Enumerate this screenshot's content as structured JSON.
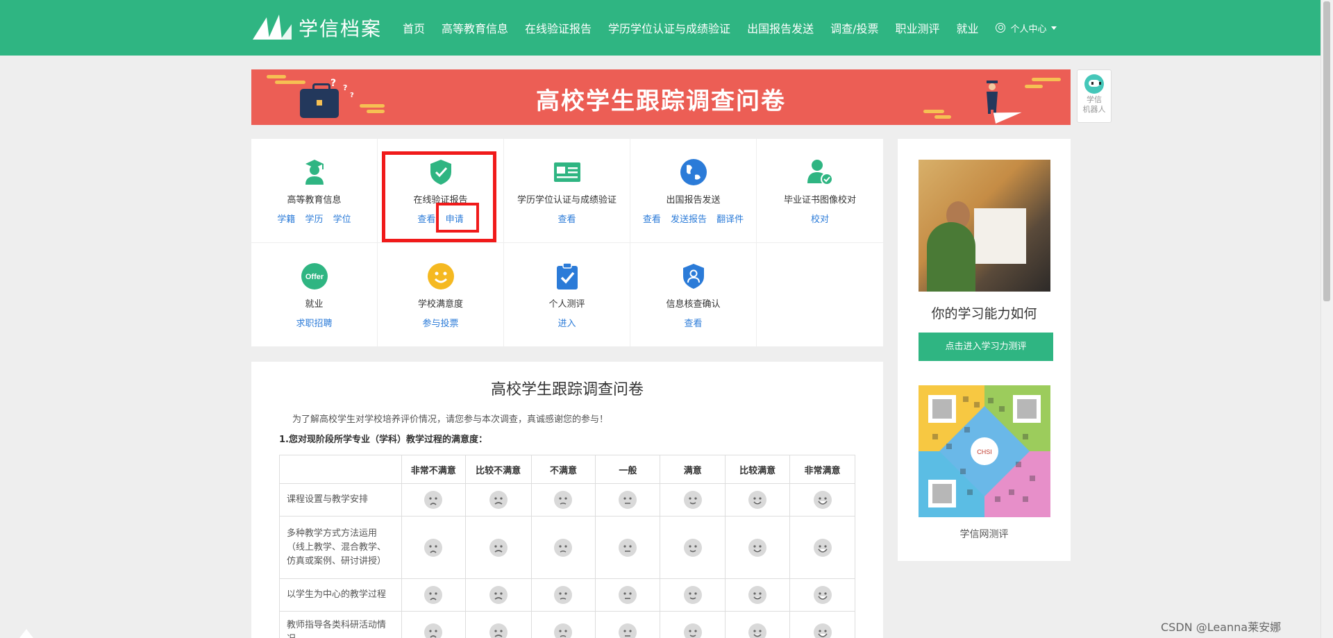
{
  "header": {
    "logo_text": "学信档案",
    "nav": [
      "首页",
      "高等教育信息",
      "在线验证报告",
      "学历学位认证与成绩验证",
      "出国报告发送",
      "调查/投票",
      "职业测评",
      "就业"
    ],
    "user_menu": "个人中心"
  },
  "banner": {
    "title": "高校学生跟踪调查问卷"
  },
  "robot": {
    "line1": "学信",
    "line2": "机器人"
  },
  "services": [
    {
      "title": "高等教育信息",
      "links": [
        "学籍",
        "学历",
        "学位"
      ],
      "icon": "graduate-icon",
      "color": "#2fb582"
    },
    {
      "title": "在线验证报告",
      "links": [
        "查看",
        "申请"
      ],
      "icon": "shield-check-icon",
      "color": "#2fb582"
    },
    {
      "title": "学历学位认证与成绩验证",
      "links": [
        "查看"
      ],
      "icon": "id-card-icon",
      "color": "#2fb582"
    },
    {
      "title": "出国报告发送",
      "links": [
        "查看",
        "发送报告",
        "翻译件"
      ],
      "icon": "globe-icon",
      "color": "#2b7bd8"
    },
    {
      "title": "毕业证书图像校对",
      "links": [
        "校对"
      ],
      "icon": "user-check-icon",
      "color": "#2fb582"
    },
    {
      "title": "就业",
      "links": [
        "求职招聘"
      ],
      "icon": "offer-icon",
      "color": "#2fb582",
      "icon_text": "Offer"
    },
    {
      "title": "学校满意度",
      "links": [
        "参与投票"
      ],
      "icon": "smiley-icon",
      "color": "#f5b921"
    },
    {
      "title": "个人测评",
      "links": [
        "进入"
      ],
      "icon": "clipboard-check-icon",
      "color": "#2b7bd8"
    },
    {
      "title": "信息核查确认",
      "links": [
        "查看"
      ],
      "icon": "shield-user-icon",
      "color": "#2b7bd8"
    }
  ],
  "survey": {
    "title": "高校学生跟踪调查问卷",
    "intro": "为了解高校学生对学校培养评价情况，请您参与本次调查，真诚感谢您的参与！",
    "question": "1.您对现阶段所学专业（学科）教学过程的满意度：",
    "columns": [
      "非常不满意",
      "比较不满意",
      "不满意",
      "一般",
      "满意",
      "比较满意",
      "非常满意"
    ],
    "rows": [
      {
        "label": "课程设置与教学安排"
      },
      {
        "label": "多种教学方式方法运用（线上教学、混合教学、仿真或案例、研讨讲授）"
      },
      {
        "label": "以学生为中心的教学过程"
      },
      {
        "label": "教师指导各类科研活动情况"
      }
    ]
  },
  "side": {
    "heading": "你的学习能力如何",
    "button": "点击进入学习力测评",
    "qr_label": "学信网测评",
    "qr_center_text": "CHSI"
  },
  "watermark": "CSDN @Leanna莱安娜",
  "colors": {
    "primary": "#2fb582",
    "banner": "#ec5e55",
    "link": "#2b7bd8",
    "highlight": "#f01a1a"
  }
}
